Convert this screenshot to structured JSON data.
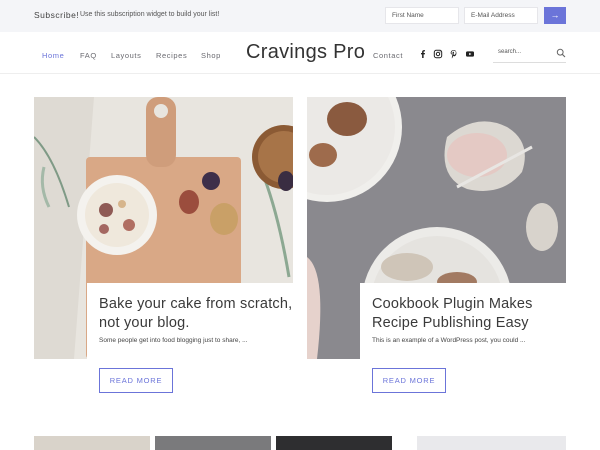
{
  "subscribe": {
    "title": "Subscribe!",
    "description": "Use this subscription widget to build your list!",
    "first_name_placeholder": "First Name",
    "email_placeholder": "E-Mail Address",
    "submit_label": "→"
  },
  "header": {
    "site_title": "Cravings Pro",
    "nav_left": [
      "Home",
      "FAQ",
      "Layouts",
      "Recipes",
      "Shop"
    ],
    "nav_right": [
      "Contact"
    ],
    "social_icons": [
      "facebook-icon",
      "instagram-icon",
      "pinterest-icon",
      "youtube-icon"
    ],
    "search_placeholder": "search..."
  },
  "posts": [
    {
      "title": "Bake your cake from scratch, not your blog.",
      "excerpt": "Some people get into food blogging just to share, ...",
      "button": "READ MORE"
    },
    {
      "title": "Cookbook Plugin Makes Recipe Publishing Easy",
      "excerpt": "This is an example of a WordPress post, you could ...",
      "button": "READ MORE"
    }
  ],
  "colors": {
    "accent": "#6b74d9",
    "subscribe_bg": "#f4f5f8",
    "text": "#333333"
  }
}
